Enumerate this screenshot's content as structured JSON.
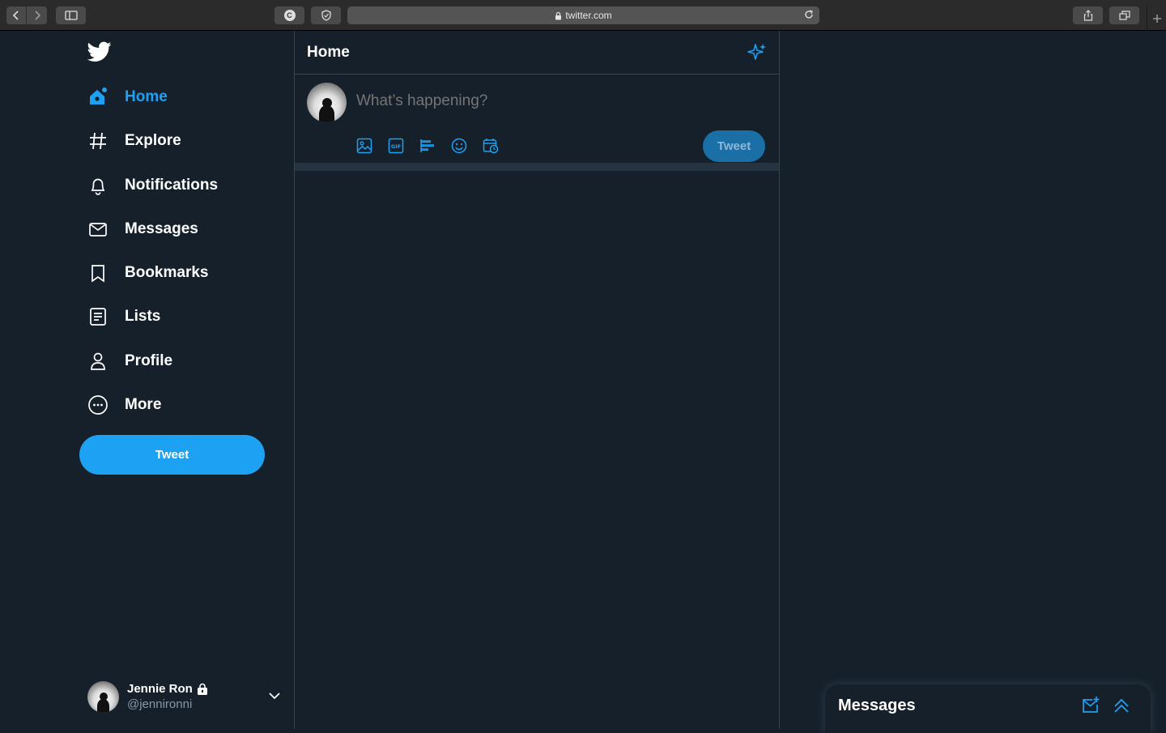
{
  "browser": {
    "url": "twitter.com",
    "extension_badge": "C"
  },
  "sidebar": {
    "items": [
      {
        "id": "home",
        "label": "Home",
        "icon": "home-icon",
        "active": true
      },
      {
        "id": "explore",
        "label": "Explore",
        "icon": "hashtag-icon",
        "active": false
      },
      {
        "id": "notifications",
        "label": "Notifications",
        "icon": "bell-icon",
        "active": false
      },
      {
        "id": "messages",
        "label": "Messages",
        "icon": "envelope-icon",
        "active": false
      },
      {
        "id": "bookmarks",
        "label": "Bookmarks",
        "icon": "bookmark-icon",
        "active": false
      },
      {
        "id": "lists",
        "label": "Lists",
        "icon": "list-icon",
        "active": false
      },
      {
        "id": "profile",
        "label": "Profile",
        "icon": "person-icon",
        "active": false
      },
      {
        "id": "more",
        "label": "More",
        "icon": "more-circle-icon",
        "active": false
      }
    ],
    "tweet_button": "Tweet",
    "account": {
      "name": "Jennie Ron",
      "handle": "@jennironni",
      "protected": true
    }
  },
  "main": {
    "title": "Home",
    "compose": {
      "placeholder": "What’s happening?",
      "tweet_button": "Tweet",
      "tools": [
        "image-icon",
        "gif-icon",
        "poll-icon",
        "emoji-icon",
        "schedule-icon"
      ]
    }
  },
  "drawer": {
    "title": "Messages"
  },
  "colors": {
    "background": "#15202b",
    "accent": "#1da1f2",
    "muted": "#8899a6",
    "border": "#38444d"
  }
}
